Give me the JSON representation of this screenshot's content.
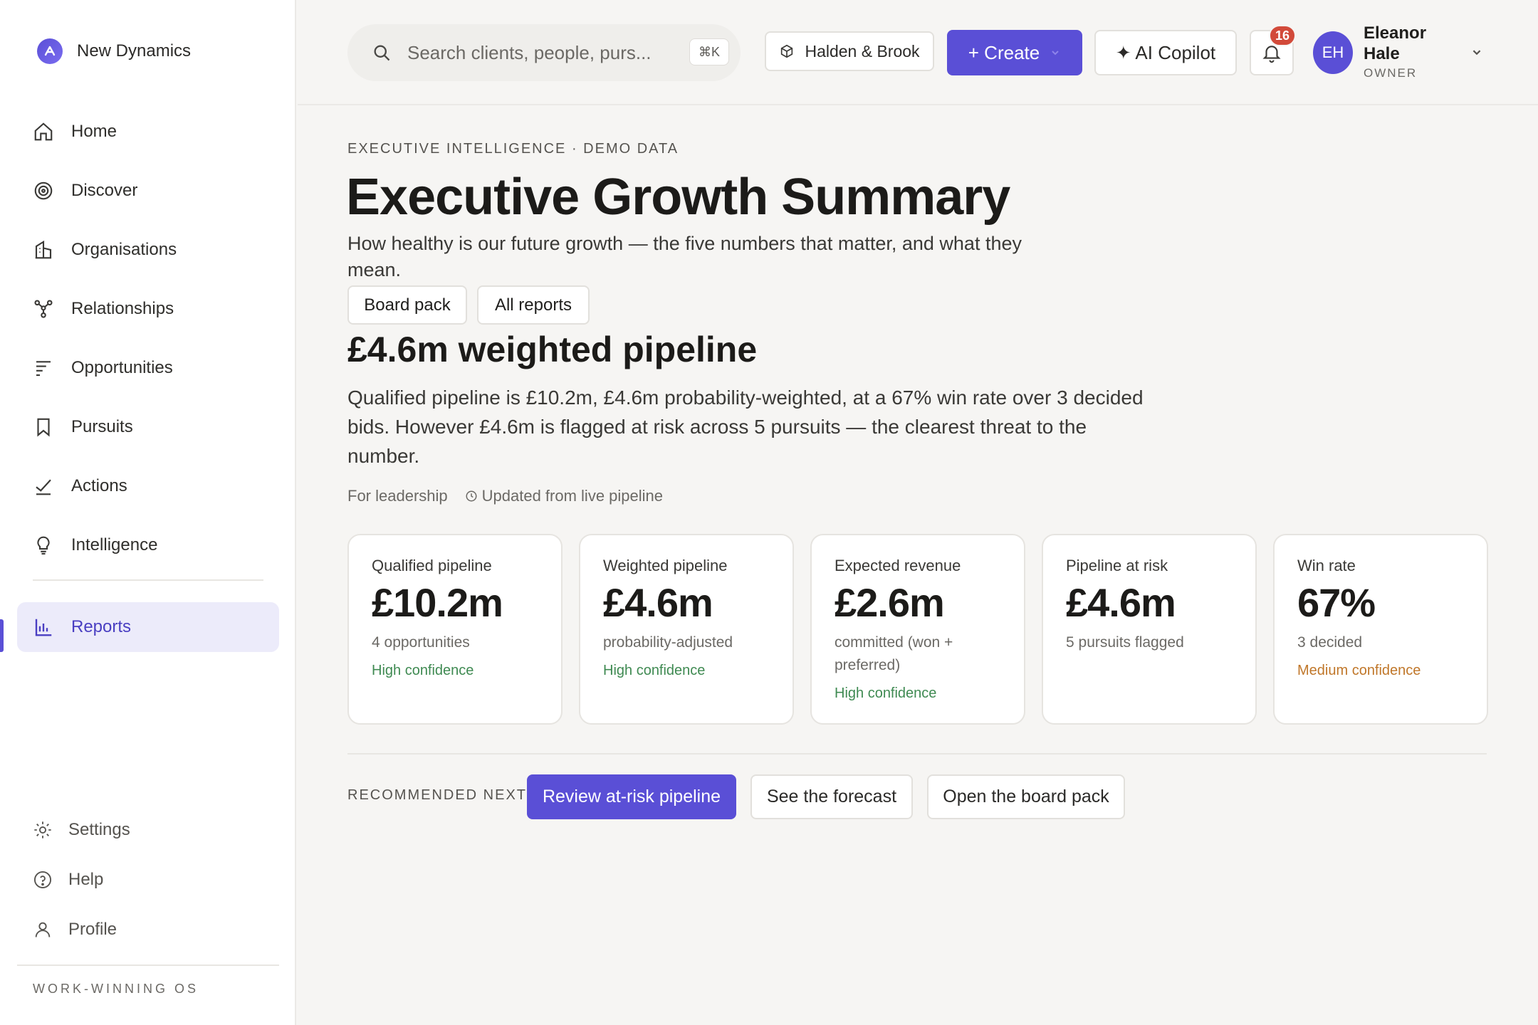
{
  "brand": {
    "name": "New Dynamics"
  },
  "nav": {
    "items": [
      {
        "label": "Home",
        "icon": "home-icon"
      },
      {
        "label": "Discover",
        "icon": "target-icon"
      },
      {
        "label": "Organisations",
        "icon": "building-icon"
      },
      {
        "label": "Relationships",
        "icon": "network-icon"
      },
      {
        "label": "Opportunities",
        "icon": "list-icon"
      },
      {
        "label": "Pursuits",
        "icon": "bookmark-icon"
      },
      {
        "label": "Actions",
        "icon": "check-icon"
      },
      {
        "label": "Intelligence",
        "icon": "lightbulb-icon"
      },
      {
        "label": "Reports",
        "icon": "bar-chart-icon",
        "active": true
      }
    ],
    "bottom": [
      {
        "label": "Settings",
        "icon": "gear-icon"
      },
      {
        "label": "Help",
        "icon": "help-icon"
      },
      {
        "label": "Profile",
        "icon": "user-icon"
      }
    ],
    "footer": "WORK-WINNING OS"
  },
  "header": {
    "search_placeholder": "Search clients, people, purs...",
    "search_shortcut": "⌘K",
    "org_label": "Halden & Brook",
    "create_label": "+ Create",
    "copilot_label": "✦ AI Copilot",
    "notification_count": "16",
    "user": {
      "initials": "EH",
      "name": "Eleanor Hale",
      "role": "OWNER"
    }
  },
  "page": {
    "eyebrow": "EXECUTIVE INTELLIGENCE · DEMO DATA",
    "title": "Executive Growth Summary",
    "subtitle": "How healthy is our future growth — the five numbers that matter, and what they mean.",
    "pills": [
      "Board pack",
      "All reports"
    ],
    "headline": "£4.6m weighted pipeline",
    "summary": "Qualified pipeline is £10.2m, £4.6m probability-weighted, at a 67% win rate over 3 decided bids. However £4.6m is flagged at risk across 5 pursuits — the clearest threat to the number.",
    "meta_audience": "For leadership",
    "meta_updated": "Updated from live pipeline"
  },
  "kpis": [
    {
      "label": "Qualified pipeline",
      "value": "£10.2m",
      "note": "4 opportunities",
      "confidence": "High confidence",
      "level": "high"
    },
    {
      "label": "Weighted pipeline",
      "value": "£4.6m",
      "note": "probability-adjusted",
      "confidence": "High confidence",
      "level": "high"
    },
    {
      "label": "Expected revenue",
      "value": "£2.6m",
      "note": "committed (won + preferred)",
      "confidence": "High confidence",
      "level": "high"
    },
    {
      "label": "Pipeline at risk",
      "value": "£4.6m",
      "note": "5 pursuits flagged",
      "confidence": "",
      "level": "none"
    },
    {
      "label": "Win rate",
      "value": "67%",
      "note": "3 decided",
      "confidence": "Medium confidence",
      "level": "medium"
    }
  ],
  "recommended": {
    "label": "RECOMMENDED NEXT",
    "actions": [
      "Review at-risk pipeline",
      "See the forecast",
      "Open the board pack"
    ]
  },
  "colors": {
    "accent": "#5a4fd6",
    "high": "#3f8a52",
    "medium": "#c0772a",
    "badge": "#d24a3a"
  }
}
